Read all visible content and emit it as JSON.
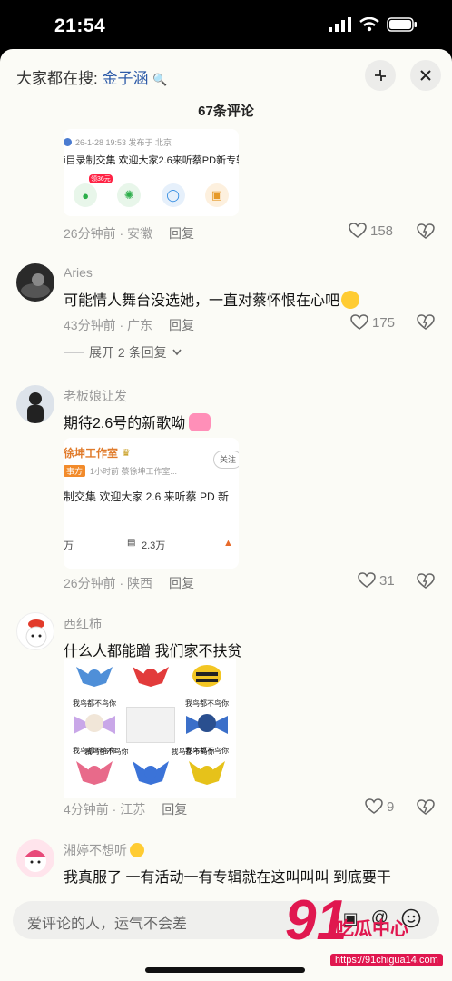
{
  "status": {
    "time": "21:54"
  },
  "header": {
    "search_prefix": "大家都在搜:",
    "search_keyword": "金子涵",
    "title": "67条评论"
  },
  "comment0": {
    "card": {
      "meta": "26-1-28 19:53 发布于 北京",
      "text": "i目录制交集 欢迎大家2.6来听蔡PD新专辑",
      "badge": "领36元"
    },
    "meta": "26分钟前 · 安徽",
    "reply": "回复",
    "likes": "158"
  },
  "comment1": {
    "username": "Aries",
    "text": "可能情人舞台没选她，一直对蔡怀恨在心吧",
    "meta": "43分钟前 · 广东",
    "reply": "回复",
    "likes": "175",
    "expand_label": "展开 2 条回复"
  },
  "comment2": {
    "username": "老板娘让发",
    "text": "期待2.6号的新歌呦",
    "card": {
      "name": "徐坤工作室",
      "tag": "事方",
      "meta": "1小时前  蔡徐坤工作室...",
      "follow": "关注",
      "text": "制交集 欢迎大家 2.6 来听蔡 PD 新",
      "stat_left": "万",
      "stat_mid": "2.3万"
    },
    "meta": "26分钟前 · 陕西",
    "reply": "回复",
    "likes": "31"
  },
  "comment3": {
    "username": "西红柿",
    "text": "什么人都能蹭 我们家不扶贫",
    "stickers": [
      "我鸟都不鸟你",
      "我鸟都不鸟你",
      "我鸟都不鸟你",
      "我鸟都不鸟你",
      "我鸟都不鸟你",
      "我鸟都不鸟你"
    ],
    "meta": "4分钟前 · 江苏",
    "reply": "回复",
    "likes": "9"
  },
  "comment4": {
    "username": "湘婷不想听",
    "text": "我真服了 一有活动一有专辑就在这叫叫叫 到底要干"
  },
  "input": {
    "placeholder": "爱评论的人，运气不会差"
  },
  "watermark": {
    "number": "91",
    "name": "吃瓜中心",
    "url": "https://91chigua14.com"
  },
  "colors": {
    "accent_keyword": "#2c5aa8",
    "watermark": "#e0174f"
  }
}
